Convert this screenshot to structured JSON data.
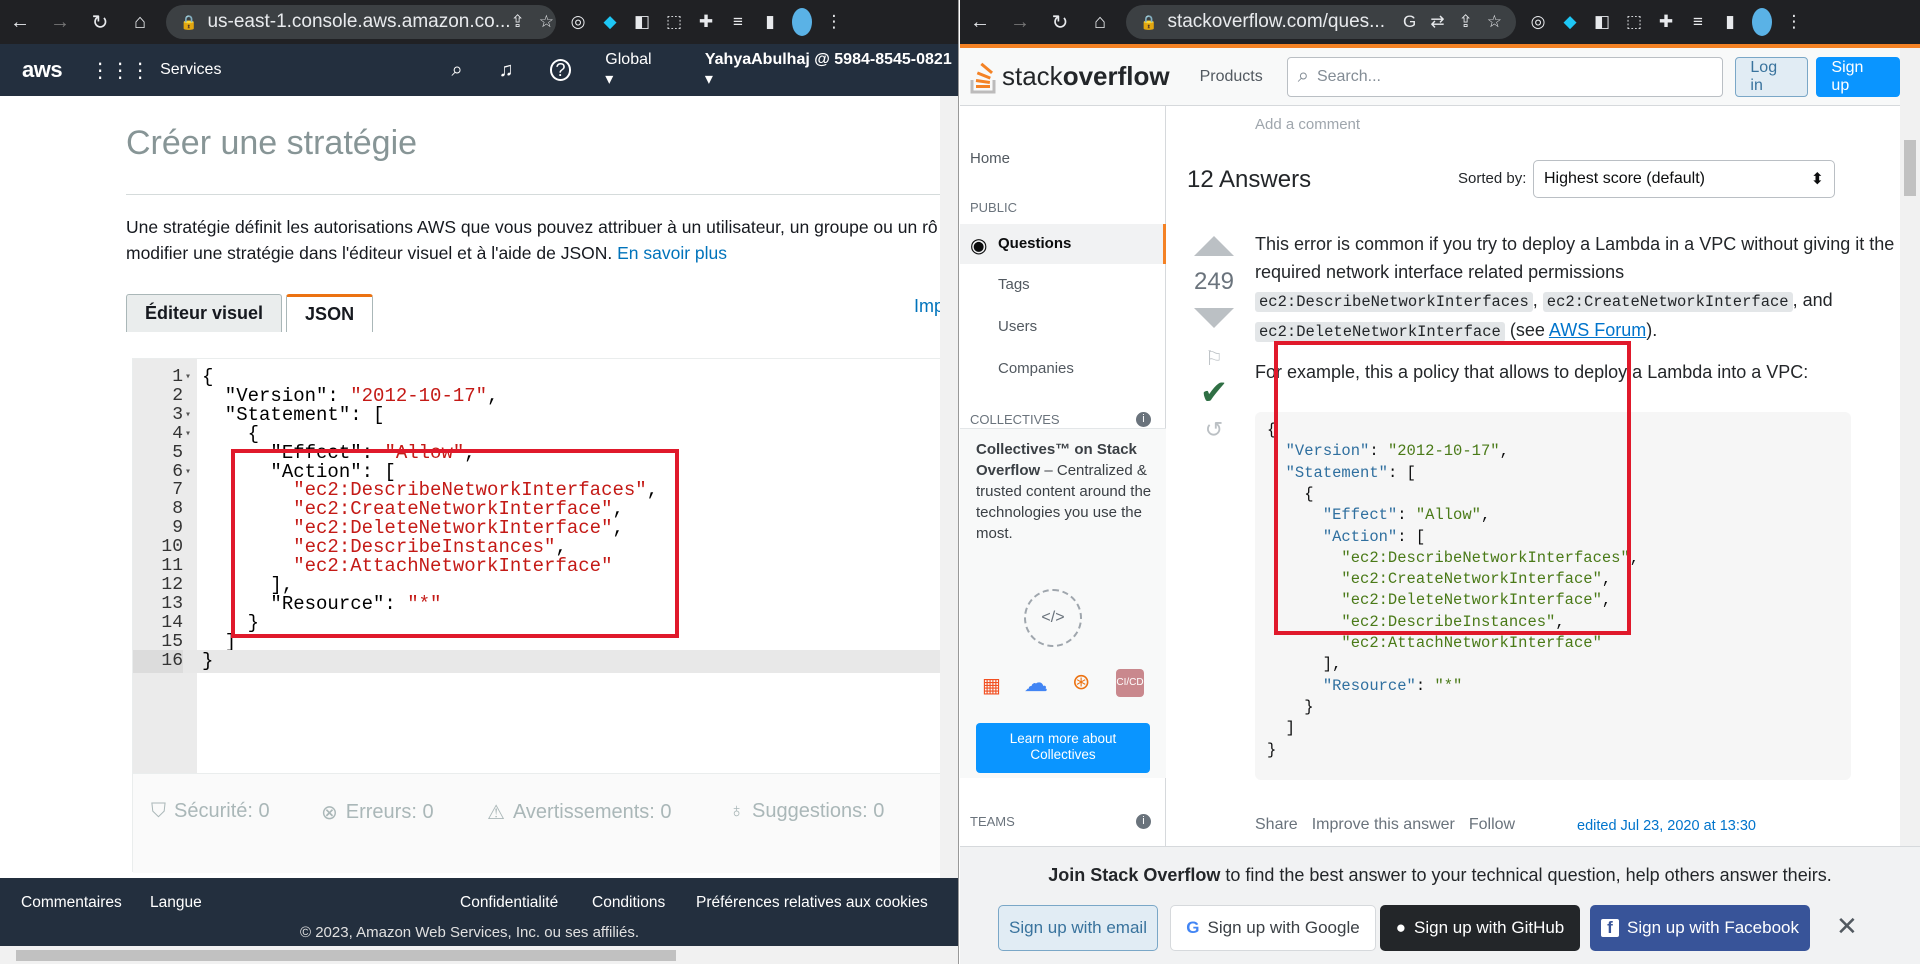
{
  "left_browser": {
    "url": "us-east-1.console.aws.amazon.co..."
  },
  "right_browser": {
    "url": "stackoverflow.com/ques..."
  },
  "aws": {
    "logo": "aws",
    "services": "Services",
    "region": "Global",
    "account": "YahyaAbulhaj @ 5984-8545-0821",
    "title": "Créer une stratégie",
    "desc_line1": "Une stratégie définit les autorisations AWS que vous pouvez attribuer à un utilisateur, un groupe ou un rô",
    "desc_line2": "modifier une stratégie dans l'éditeur visuel et à l'aide de JSON.",
    "desc_link": "En savoir plus",
    "tab_visual": "Éditeur visuel",
    "tab_json": "JSON",
    "import_link": "Imp",
    "code_lines": [
      {
        "n": "1",
        "fold": true,
        "t": "{"
      },
      {
        "n": "2",
        "fold": false,
        "t": "  \"Version\": ",
        "s": "\"2012-10-17\"",
        "e": ","
      },
      {
        "n": "3",
        "fold": true,
        "t": "  \"Statement\": ["
      },
      {
        "n": "4",
        "fold": true,
        "t": "    {"
      },
      {
        "n": "5",
        "fold": false,
        "t": "      \"Effect\": ",
        "s": "\"Allow\"",
        "e": ","
      },
      {
        "n": "6",
        "fold": true,
        "t": "      \"Action\": ["
      },
      {
        "n": "7",
        "fold": false,
        "t": "        ",
        "s": "\"ec2:DescribeNetworkInterfaces\"",
        "e": ","
      },
      {
        "n": "8",
        "fold": false,
        "t": "        ",
        "s": "\"ec2:CreateNetworkInterface\"",
        "e": ","
      },
      {
        "n": "9",
        "fold": false,
        "t": "        ",
        "s": "\"ec2:DeleteNetworkInterface\"",
        "e": ","
      },
      {
        "n": "10",
        "fold": false,
        "t": "        ",
        "s": "\"ec2:DescribeInstances\"",
        "e": ","
      },
      {
        "n": "11",
        "fold": false,
        "t": "        ",
        "s": "\"ec2:AttachNetworkInterface\"",
        "e": ""
      },
      {
        "n": "12",
        "fold": false,
        "t": "      ],"
      },
      {
        "n": "13",
        "fold": false,
        "t": "      \"Resource\": ",
        "s": "\"*\"",
        "e": ""
      },
      {
        "n": "14",
        "fold": false,
        "t": "    }"
      },
      {
        "n": "15",
        "fold": false,
        "t": "  ]"
      },
      {
        "n": "16",
        "fold": false,
        "t": "}"
      }
    ],
    "status": {
      "security": "Sécurité: 0",
      "errors": "Erreurs: 0",
      "warnings": "Avertissements: 0",
      "suggestions": "Suggestions: 0"
    },
    "footer": {
      "feedback": "Commentaires",
      "language": "Langue",
      "privacy": "Confidentialité",
      "terms": "Conditions",
      "cookies": "Préférences relatives aux cookies",
      "copyright": "© 2023, Amazon Web Services, Inc. ou ses affiliés."
    }
  },
  "so": {
    "logo_a": "stack",
    "logo_b": "overflow",
    "products": "Products",
    "search_placeholder": "Search...",
    "login": "Log in",
    "signup": "Sign up",
    "add_comment": "Add a comment",
    "sidebar": {
      "home": "Home",
      "public": "PUBLIC",
      "questions": "Questions",
      "tags": "Tags",
      "users": "Users",
      "companies": "Companies",
      "collectives": "COLLECTIVES",
      "teams": "TEAMS",
      "coll_title": "Collectives™ on Stack Overflow",
      "coll_text": " – Centralized & trusted content around the technologies you use the most.",
      "coll_btn": "Learn more about Collectives",
      "cicd": "CI/CD"
    },
    "answers_count": "12 Answers",
    "sorted_by": "Sorted by:",
    "sort_value": "Highest score (default)",
    "score": "249",
    "answer_p1_a": "This error is common if you try to deploy a Lambda in a VPC without giving it the required network interface related permissions ",
    "code_a": "ec2:DescribeNetworkInterfaces",
    "code_b": "ec2:CreateNetworkInterface",
    "code_c": "ec2:DeleteNetworkInterface",
    "and": ", and",
    "see": " (see ",
    "forum": "AWS Forum",
    "close_paren": ").",
    "answer_p2": "For example, this a policy that allows to deploy a Lambda into a VPC:",
    "code_lines": [
      {
        "t": "{"
      },
      {
        "t": "  ",
        "k": "\"Version\"",
        "m": ": ",
        "v": "\"2012-10-17\"",
        "e": ","
      },
      {
        "t": "  ",
        "k": "\"Statement\"",
        "m": ": ["
      },
      {
        "t": "    {"
      },
      {
        "t": "      ",
        "k": "\"Effect\"",
        "m": ": ",
        "v": "\"Allow\"",
        "e": ","
      },
      {
        "t": "      ",
        "k": "\"Action\"",
        "m": ": ["
      },
      {
        "t": "        ",
        "v": "\"ec2:DescribeNetworkInterfaces\"",
        "e": ","
      },
      {
        "t": "        ",
        "v": "\"ec2:CreateNetworkInterface\"",
        "e": ","
      },
      {
        "t": "        ",
        "v": "\"ec2:DeleteNetworkInterface\"",
        "e": ","
      },
      {
        "t": "        ",
        "v": "\"ec2:DescribeInstances\"",
        "e": ","
      },
      {
        "t": "        ",
        "v": "\"ec2:AttachNetworkInterface\""
      },
      {
        "t": "      ],"
      },
      {
        "t": "      ",
        "k": "\"Resource\"",
        "m": ": ",
        "v": "\"*\""
      },
      {
        "t": "    }"
      },
      {
        "t": "  ]"
      },
      {
        "t": "}"
      }
    ],
    "share": "Share",
    "improve": "Improve this answer",
    "follow": "Follow",
    "edited": "edited Jul 23, 2020 at 13:30",
    "join_bold": "Join Stack Overflow",
    "join_rest": " to find the best answer to your technical question, help others answer theirs.",
    "btn_email": "Sign up with email",
    "btn_google": "Sign up with Google",
    "btn_github": "Sign up with GitHub",
    "btn_facebook": "Sign up with Facebook"
  },
  "colors": {
    "aws_nav": "#232f3e",
    "aws_orange": "#ec7211",
    "so_orange": "#f48225",
    "so_blue": "#0a95ff",
    "highlight": "#e0192b"
  }
}
